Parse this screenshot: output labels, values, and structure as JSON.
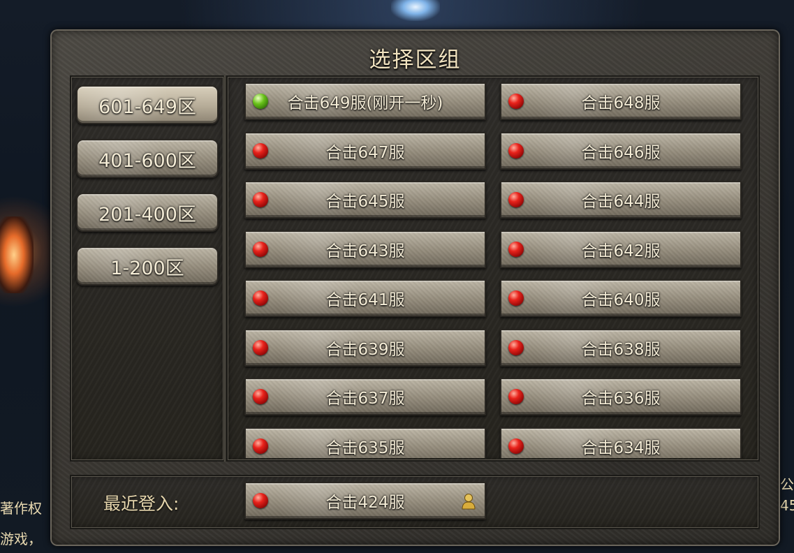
{
  "background": {
    "left_text_1": "著作权",
    "left_text_2": "游戏，",
    "right_text_1": "公",
    "right_text_2": "45"
  },
  "dialog": {
    "title": "选择区组"
  },
  "zones": [
    {
      "label": "601-649区",
      "active": true
    },
    {
      "label": "401-600区",
      "active": false
    },
    {
      "label": "201-400区",
      "active": false
    },
    {
      "label": "1-200区",
      "active": false
    }
  ],
  "servers": [
    {
      "label": "合击649服(刚开一秒)",
      "status": "green"
    },
    {
      "label": "合击648服",
      "status": "red"
    },
    {
      "label": "合击647服",
      "status": "red"
    },
    {
      "label": "合击646服",
      "status": "red"
    },
    {
      "label": "合击645服",
      "status": "red"
    },
    {
      "label": "合击644服",
      "status": "red"
    },
    {
      "label": "合击643服",
      "status": "red"
    },
    {
      "label": "合击642服",
      "status": "red"
    },
    {
      "label": "合击641服",
      "status": "red"
    },
    {
      "label": "合击640服",
      "status": "red"
    },
    {
      "label": "合击639服",
      "status": "red"
    },
    {
      "label": "合击638服",
      "status": "red"
    },
    {
      "label": "合击637服",
      "status": "red"
    },
    {
      "label": "合击636服",
      "status": "red"
    },
    {
      "label": "合击635服",
      "status": "red"
    },
    {
      "label": "合击634服",
      "status": "red"
    }
  ],
  "recent": {
    "label": "最近登入:",
    "server": {
      "label": "合击424服",
      "status": "red",
      "icon": "player-icon"
    }
  },
  "colors": {
    "status_green": "#69c21a",
    "status_red": "#e8221b",
    "title_text": "#f0e2bf"
  }
}
